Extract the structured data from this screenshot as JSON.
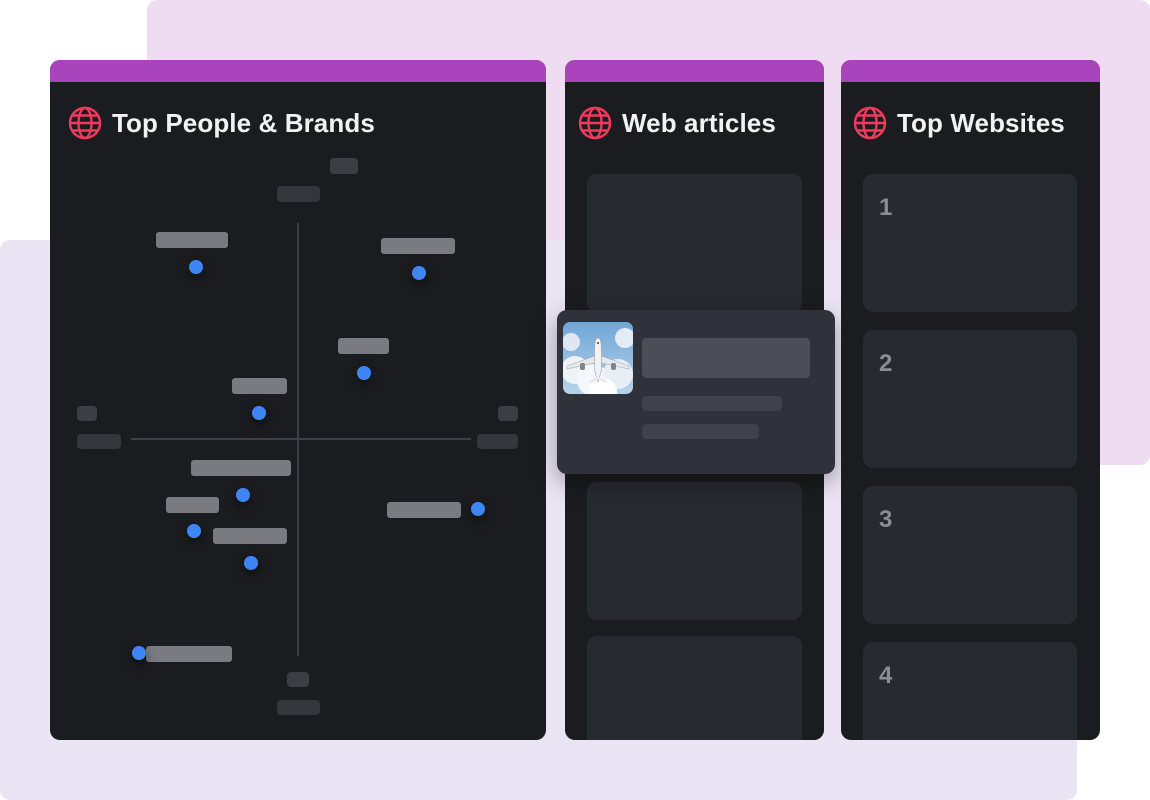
{
  "accent": "#a944bc",
  "icon_color": "#ef3a5d",
  "dot_color": "#3e86f5",
  "panels": {
    "people_brands": {
      "title": "Top People & Brands",
      "icon": "globe-icon"
    },
    "web_articles": {
      "title": "Web articles",
      "icon": "globe-icon",
      "featured_thumbnail": "airplane-image"
    },
    "top_websites": {
      "title": "Top Websites",
      "icon": "globe-icon",
      "ranks": [
        "1",
        "2",
        "3",
        "4"
      ]
    }
  }
}
